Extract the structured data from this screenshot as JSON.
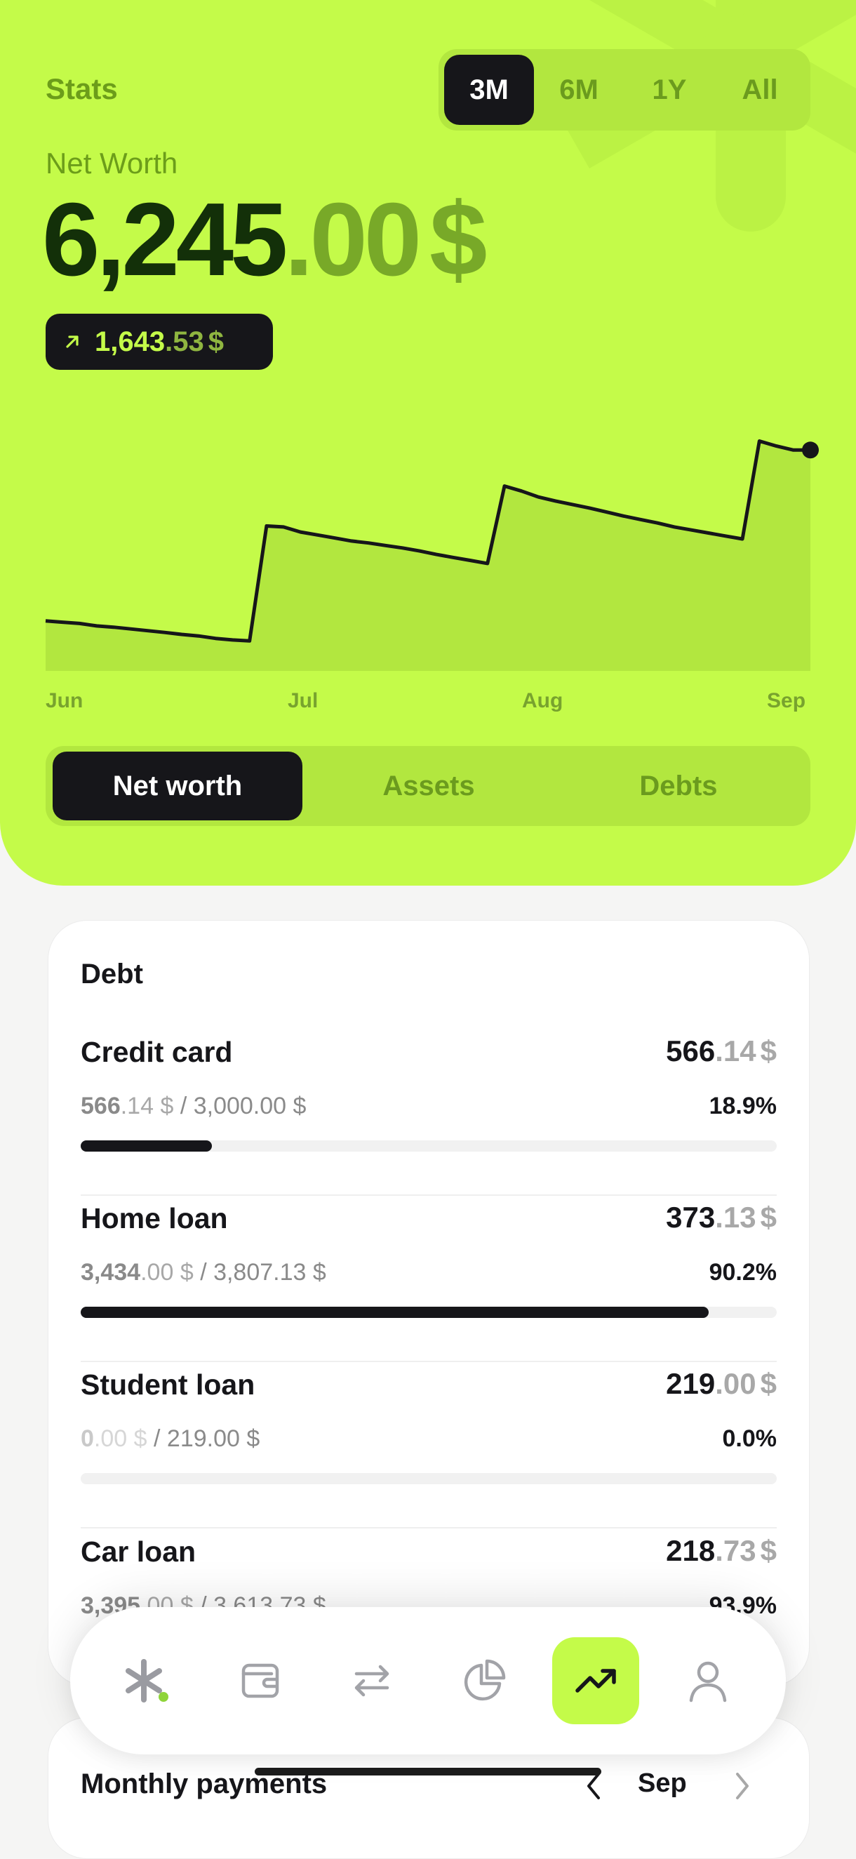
{
  "header": {
    "title": "Stats",
    "ranges": [
      {
        "label": "3M",
        "active": true
      },
      {
        "label": "6M",
        "active": false
      },
      {
        "label": "1Y",
        "active": false
      },
      {
        "label": "All",
        "active": false
      }
    ]
  },
  "net_worth": {
    "label": "Net Worth",
    "integer": "6,245",
    "decimal": ".00",
    "currency": "$",
    "change": {
      "icon": "arrow-up-right-icon",
      "integer": "1,643",
      "decimal": ".53",
      "currency": "$"
    }
  },
  "chart_data": {
    "type": "area",
    "x_ticks": [
      "Jun",
      "Jul",
      "Aug",
      "Sep"
    ],
    "values": [
      1000,
      975,
      950,
      900,
      875,
      840,
      805,
      770,
      730,
      700,
      650,
      620,
      600,
      2900,
      2880,
      2780,
      2720,
      2660,
      2600,
      2560,
      2510,
      2460,
      2400,
      2330,
      2270,
      2210,
      2150,
      3700,
      3600,
      3480,
      3400,
      3330,
      3260,
      3180,
      3100,
      3030,
      2960,
      2880,
      2820,
      2760,
      2700,
      2640,
      4600,
      4500,
      4420,
      4420
    ],
    "colors": {
      "line": "#16161a",
      "fill": "#b2e73f"
    }
  },
  "view_tabs": [
    {
      "label": "Net worth",
      "active": true
    },
    {
      "label": "Assets",
      "active": false
    },
    {
      "label": "Debts",
      "active": false
    }
  ],
  "debt": {
    "title": "Debt",
    "rows": [
      {
        "name": "Credit card",
        "amount_int": "566",
        "amount_dec": ".14",
        "currency": "$",
        "paid_int": "566",
        "paid_dec": ".14",
        "total": "/ 3,000.00",
        "percent": "18.9%",
        "progress": 0.189
      },
      {
        "name": "Home loan",
        "amount_int": "373",
        "amount_dec": ".13",
        "currency": "$",
        "paid_int": "3,434",
        "paid_dec": ".00",
        "total": "/ 3,807.13",
        "percent": "90.2%",
        "progress": 0.902
      },
      {
        "name": "Student loan",
        "amount_int": "219",
        "amount_dec": ".00",
        "currency": "$",
        "paid_int": "0",
        "paid_dec": ".00",
        "total": "/ 219.00",
        "percent": "0.0%",
        "progress": 0.0
      },
      {
        "name": "Car loan",
        "amount_int": "218",
        "amount_dec": ".73",
        "currency": "$",
        "paid_int": "3,395",
        "paid_dec": ".00",
        "total": "/ 3,613.73",
        "percent": "93.9%",
        "progress": 0.939
      }
    ]
  },
  "monthly": {
    "title": "Monthly payments",
    "month": "Sep"
  },
  "nav": {
    "items": [
      {
        "icon": "asterisk-logo-icon",
        "active": false
      },
      {
        "icon": "wallet-icon",
        "active": false
      },
      {
        "icon": "transfer-arrows-icon",
        "active": false
      },
      {
        "icon": "pie-chart-icon",
        "active": false
      },
      {
        "icon": "trending-up-icon",
        "active": true
      },
      {
        "icon": "user-icon",
        "active": false
      }
    ]
  },
  "colors": {
    "accent": "#c4fb49",
    "dark": "#16161a",
    "muted_green": "#78a928"
  }
}
